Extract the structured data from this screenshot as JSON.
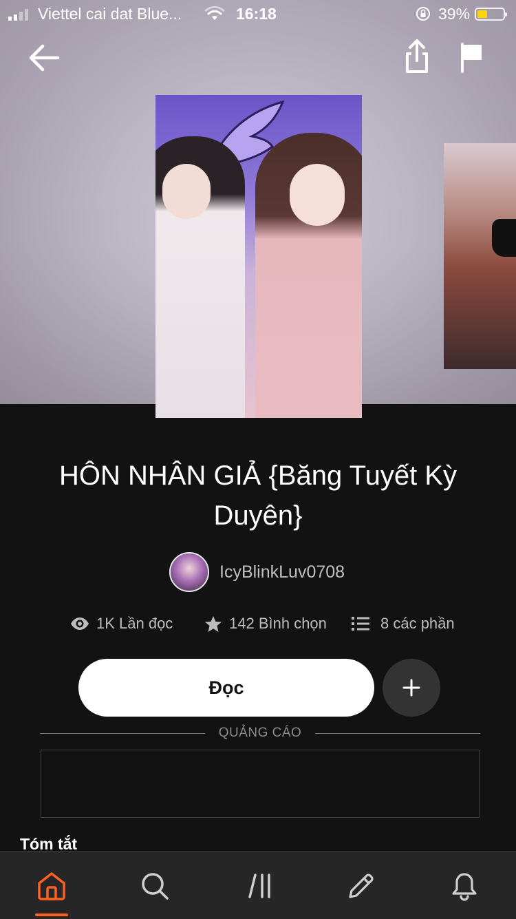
{
  "status_bar": {
    "carrier": "Viettel cai dat Blue...",
    "time": "16:18",
    "battery_percent": "39%",
    "battery_level": 0.39,
    "battery_color": "#ffd60a"
  },
  "header": {
    "back_icon": "arrow-left-icon",
    "share_icon": "share-icon",
    "flag_icon": "flag-icon"
  },
  "story": {
    "title": "HÔN NHÂN GIẢ {Băng Tuyết Kỳ Duyên}",
    "author": "IcyBlinkLuv0708",
    "reads": "1K Lần đọc",
    "votes": "142 Bình chọn",
    "parts": "8 các phần"
  },
  "actions": {
    "read_label": "Đọc",
    "add_icon": "plus-icon"
  },
  "ad": {
    "label": "QUẢNG CÁO"
  },
  "summary": {
    "heading": "Tóm tắt"
  },
  "tabbar": {
    "items": [
      "home-icon",
      "search-icon",
      "library-icon",
      "write-icon",
      "notifications-icon"
    ],
    "active_index": 0,
    "active_color": "#ff6122"
  }
}
